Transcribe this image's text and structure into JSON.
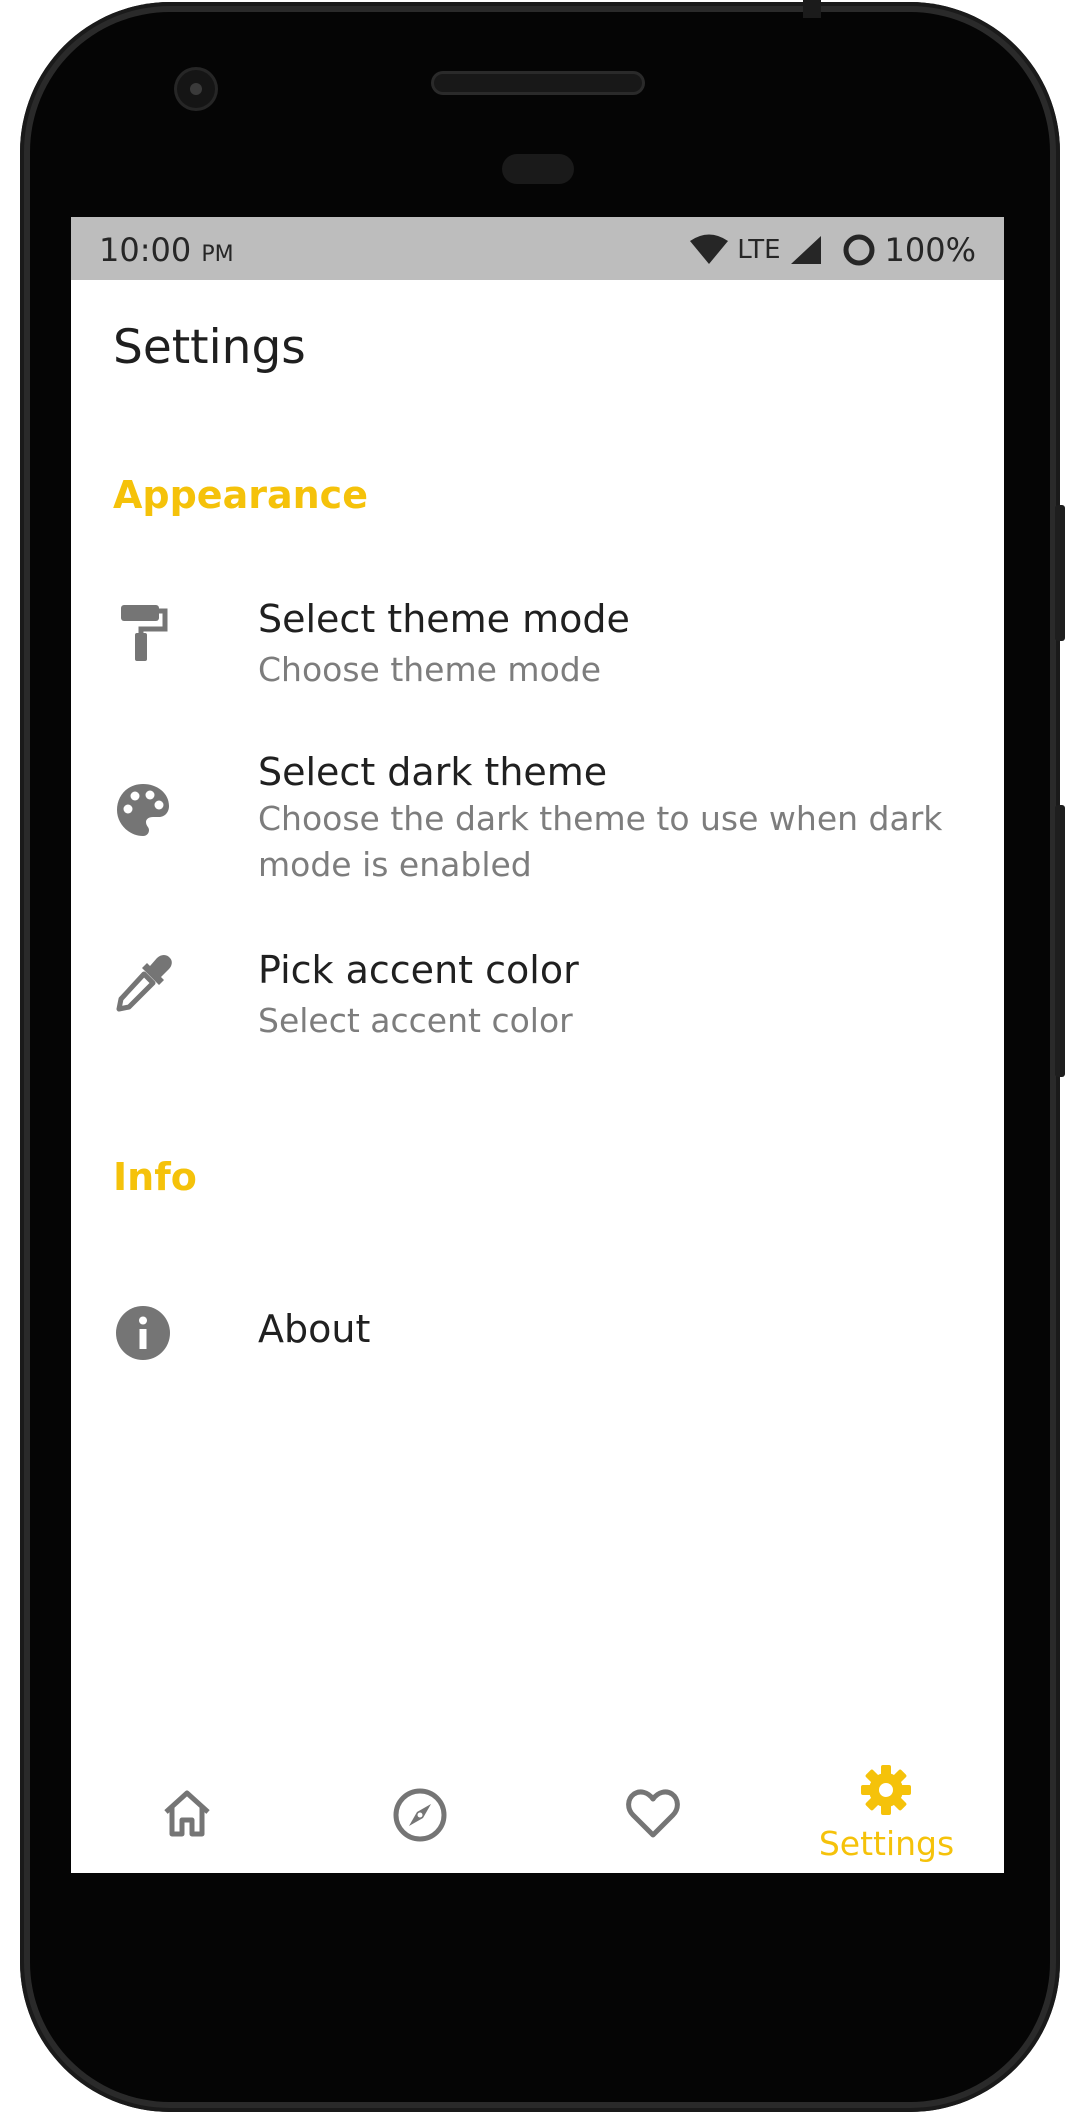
{
  "status_bar": {
    "time": "10:00",
    "ampm": "PM",
    "network": "LTE",
    "battery": "100%"
  },
  "page": {
    "title": "Settings"
  },
  "sections": [
    {
      "header": "Appearance",
      "items": [
        {
          "icon": "paint-roller-icon",
          "title": "Select theme mode",
          "subtitle": "Choose theme mode"
        },
        {
          "icon": "palette-icon",
          "title": "Select dark theme",
          "subtitle": "Choose the dark theme to use when dark mode is enabled"
        },
        {
          "icon": "eyedropper-icon",
          "title": "Pick accent color",
          "subtitle": "Select accent color"
        }
      ]
    },
    {
      "header": "Info",
      "items": [
        {
          "icon": "info-icon",
          "title": "About"
        }
      ]
    }
  ],
  "bottom_nav": {
    "items": [
      {
        "icon": "home-icon",
        "label": "",
        "selected": false
      },
      {
        "icon": "compass-icon",
        "label": "",
        "selected": false
      },
      {
        "icon": "heart-icon",
        "label": "",
        "selected": false
      },
      {
        "icon": "gear-icon",
        "label": "Settings",
        "selected": true
      }
    ]
  },
  "colors": {
    "accent": "#f5c20a",
    "icon_gray": "#757575",
    "status_bar": "#bdbdbd"
  }
}
